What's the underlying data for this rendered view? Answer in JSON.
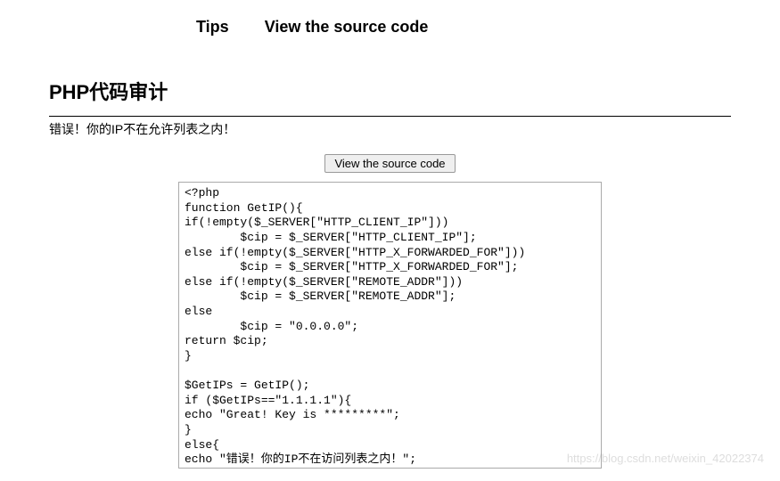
{
  "nav": {
    "tips": "Tips",
    "view_source": "View the source code"
  },
  "page": {
    "title": "PHP代码审计",
    "error_message": "错误！你的IP不在允许列表之内！"
  },
  "button": {
    "view_source": "View the source code"
  },
  "code": {
    "lines": [
      "<?php",
      "function GetIP(){",
      "if(!empty($_SERVER[\"HTTP_CLIENT_IP\"]))",
      "        $cip = $_SERVER[\"HTTP_CLIENT_IP\"];",
      "else if(!empty($_SERVER[\"HTTP_X_FORWARDED_FOR\"]))",
      "        $cip = $_SERVER[\"HTTP_X_FORWARDED_FOR\"];",
      "else if(!empty($_SERVER[\"REMOTE_ADDR\"]))",
      "        $cip = $_SERVER[\"REMOTE_ADDR\"];",
      "else",
      "        $cip = \"0.0.0.0\";",
      "return $cip;",
      "}",
      "",
      "$GetIPs = GetIP();",
      "if ($GetIPs==\"1.1.1.1\"){",
      "echo \"Great! Key is *********\";",
      "}",
      "else{",
      "echo \"错误！你的IP不在访问列表之内！\";",
      "}",
      "?>"
    ]
  },
  "watermark": "https://blog.csdn.net/weixin_42022374"
}
